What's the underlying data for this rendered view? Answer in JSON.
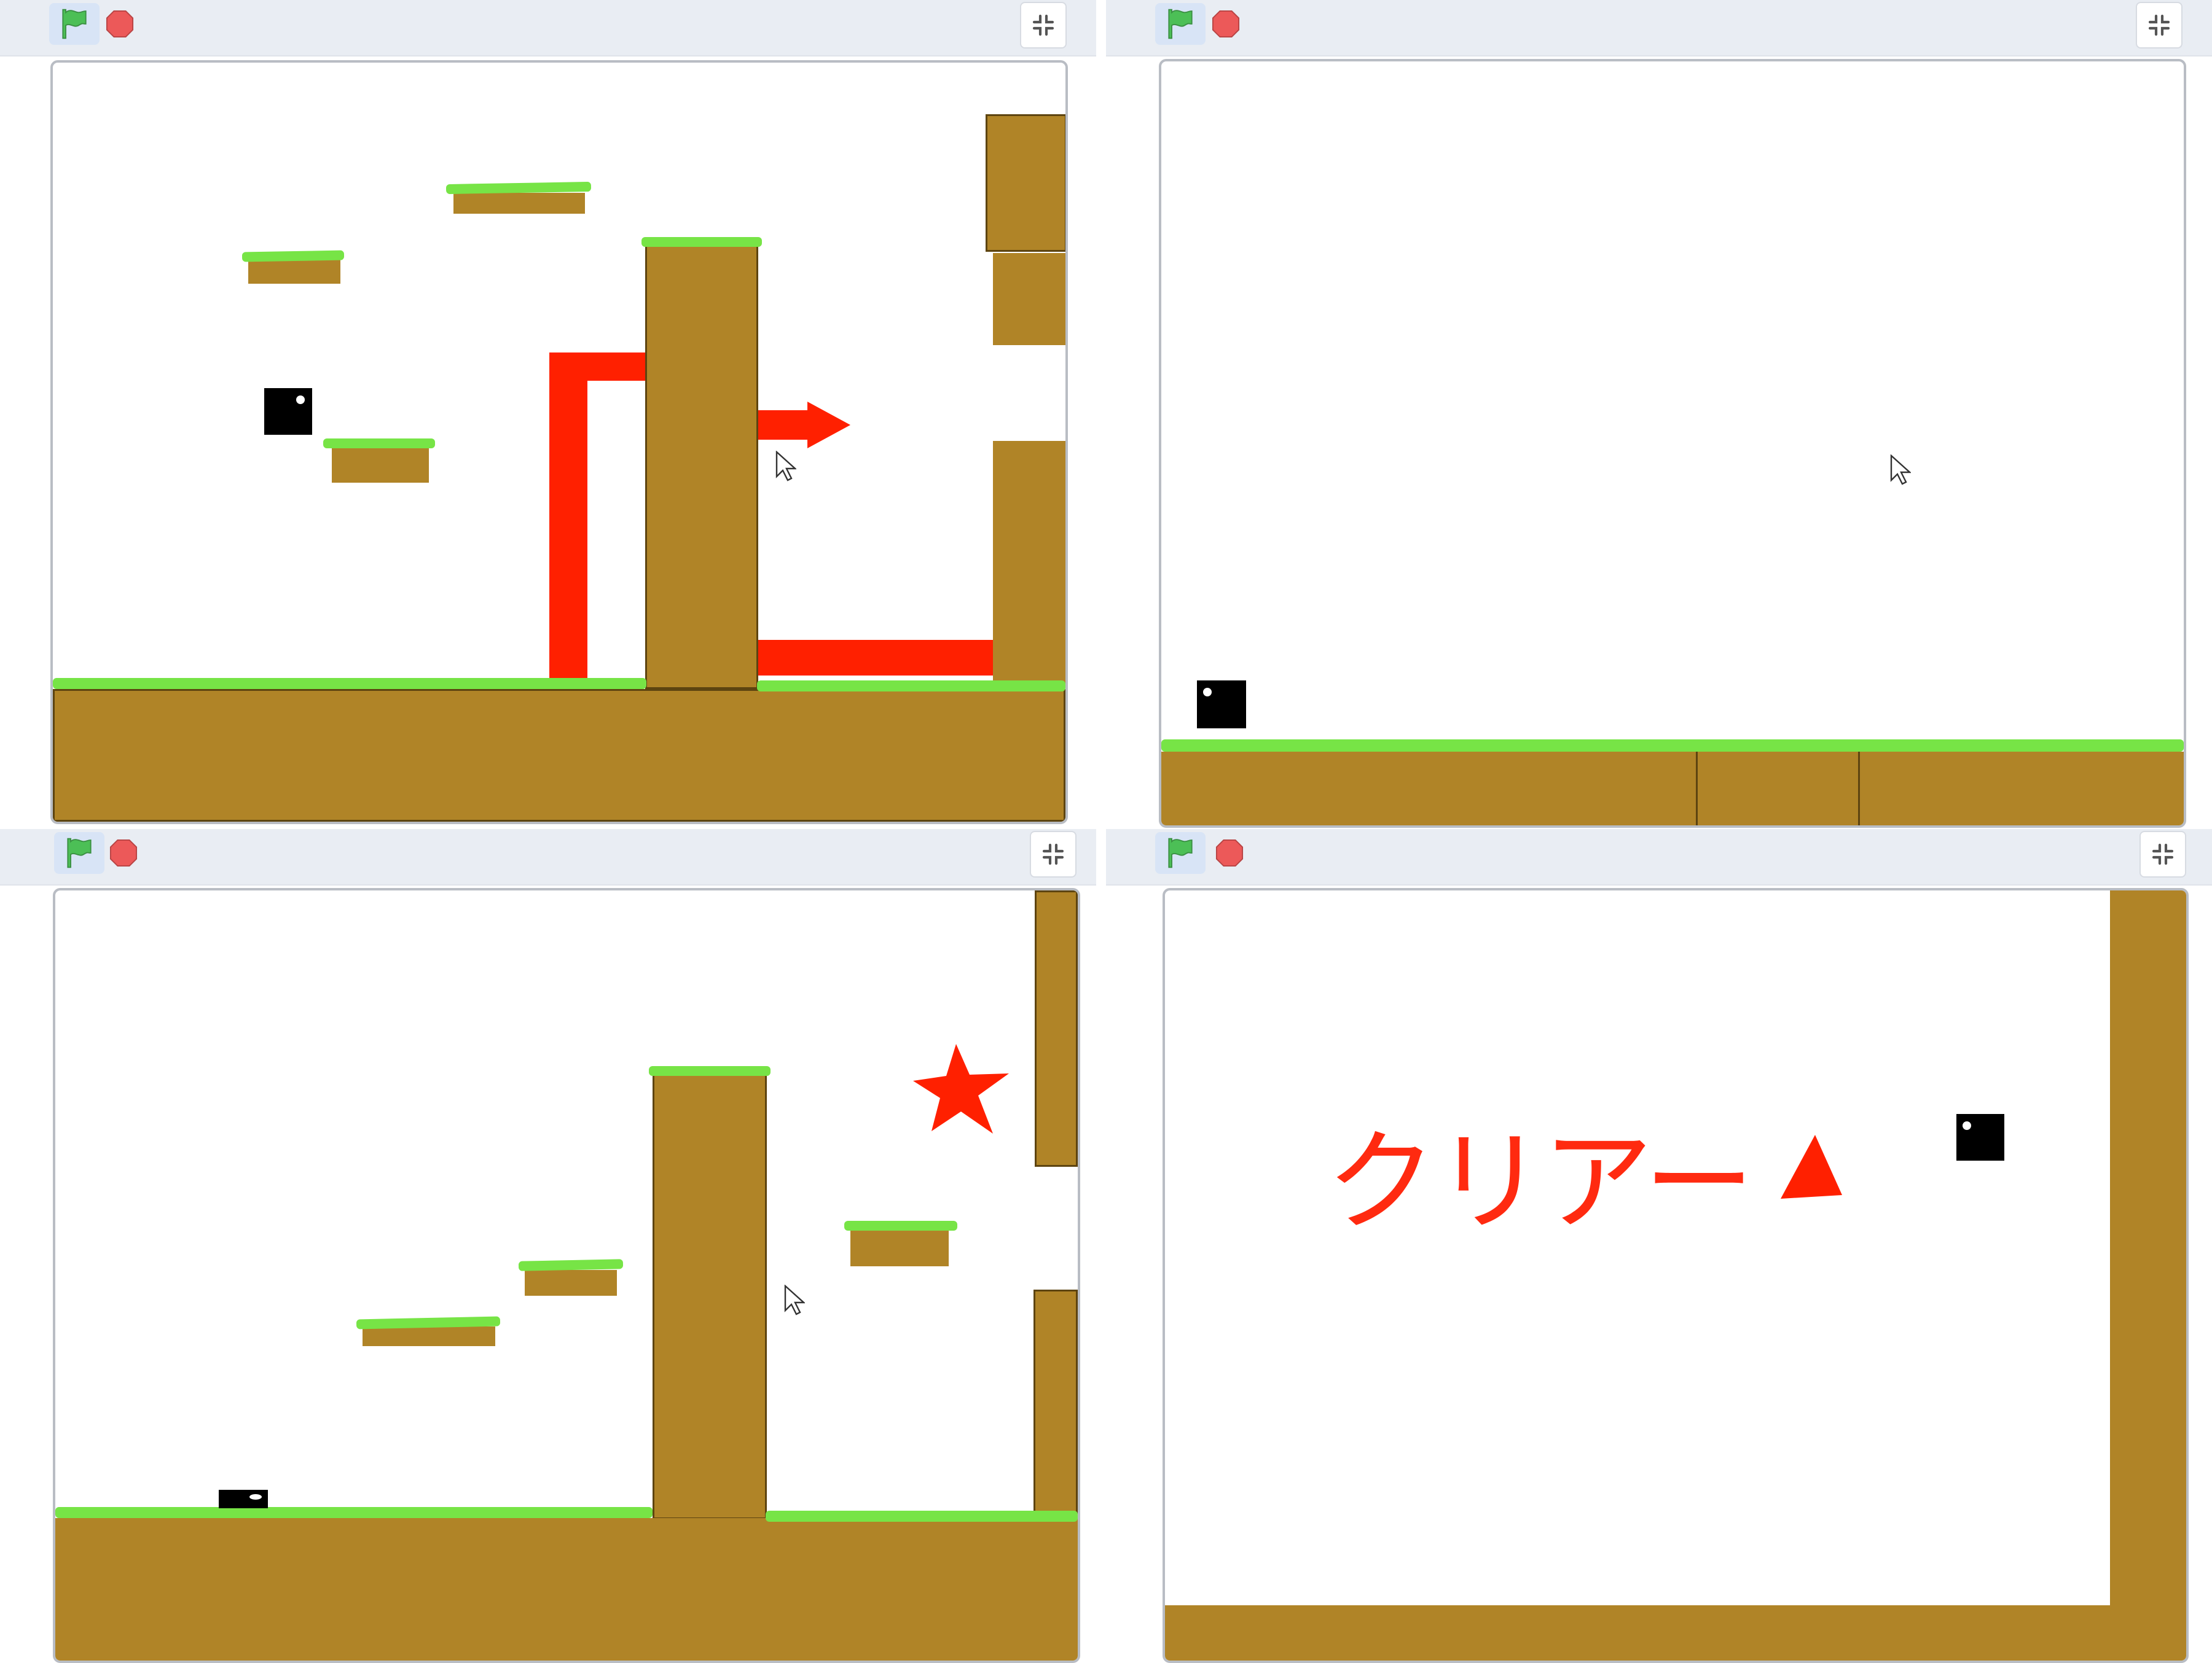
{
  "panels": [
    {
      "id": "top-left",
      "toolbar": {
        "green_flag": "green-flag-icon",
        "stop": "stop-sign-icon",
        "fullscreen": "exit-fullscreen-icon"
      },
      "player": {
        "state": "midair"
      },
      "hazards": [
        "red-pipe",
        "red-arrow",
        "red-laser-bar"
      ]
    },
    {
      "id": "top-right",
      "toolbar": {
        "green_flag": "green-flag-icon",
        "stop": "stop-sign-icon",
        "fullscreen": "exit-fullscreen-icon"
      },
      "player": {
        "state": "standing"
      }
    },
    {
      "id": "bottom-left",
      "toolbar": {
        "green_flag": "green-flag-icon",
        "stop": "stop-sign-icon",
        "fullscreen": "exit-fullscreen-icon"
      },
      "player": {
        "state": "crouching"
      },
      "hazards": [
        "red-star"
      ]
    },
    {
      "id": "bottom-right",
      "toolbar": {
        "green_flag": "green-flag-icon",
        "stop": "stop-sign-icon",
        "fullscreen": "exit-fullscreen-icon"
      },
      "player": {
        "state": "midair"
      },
      "clear_text": "クリアー"
    }
  ],
  "colors": {
    "grass": "#77e446",
    "dirt": "#b08427",
    "hazard": "#ff2000",
    "player": "#000000",
    "toolbar_bg": "#e9edf3",
    "flag_green": "#4cbf56",
    "stop_red": "#ec5959"
  }
}
